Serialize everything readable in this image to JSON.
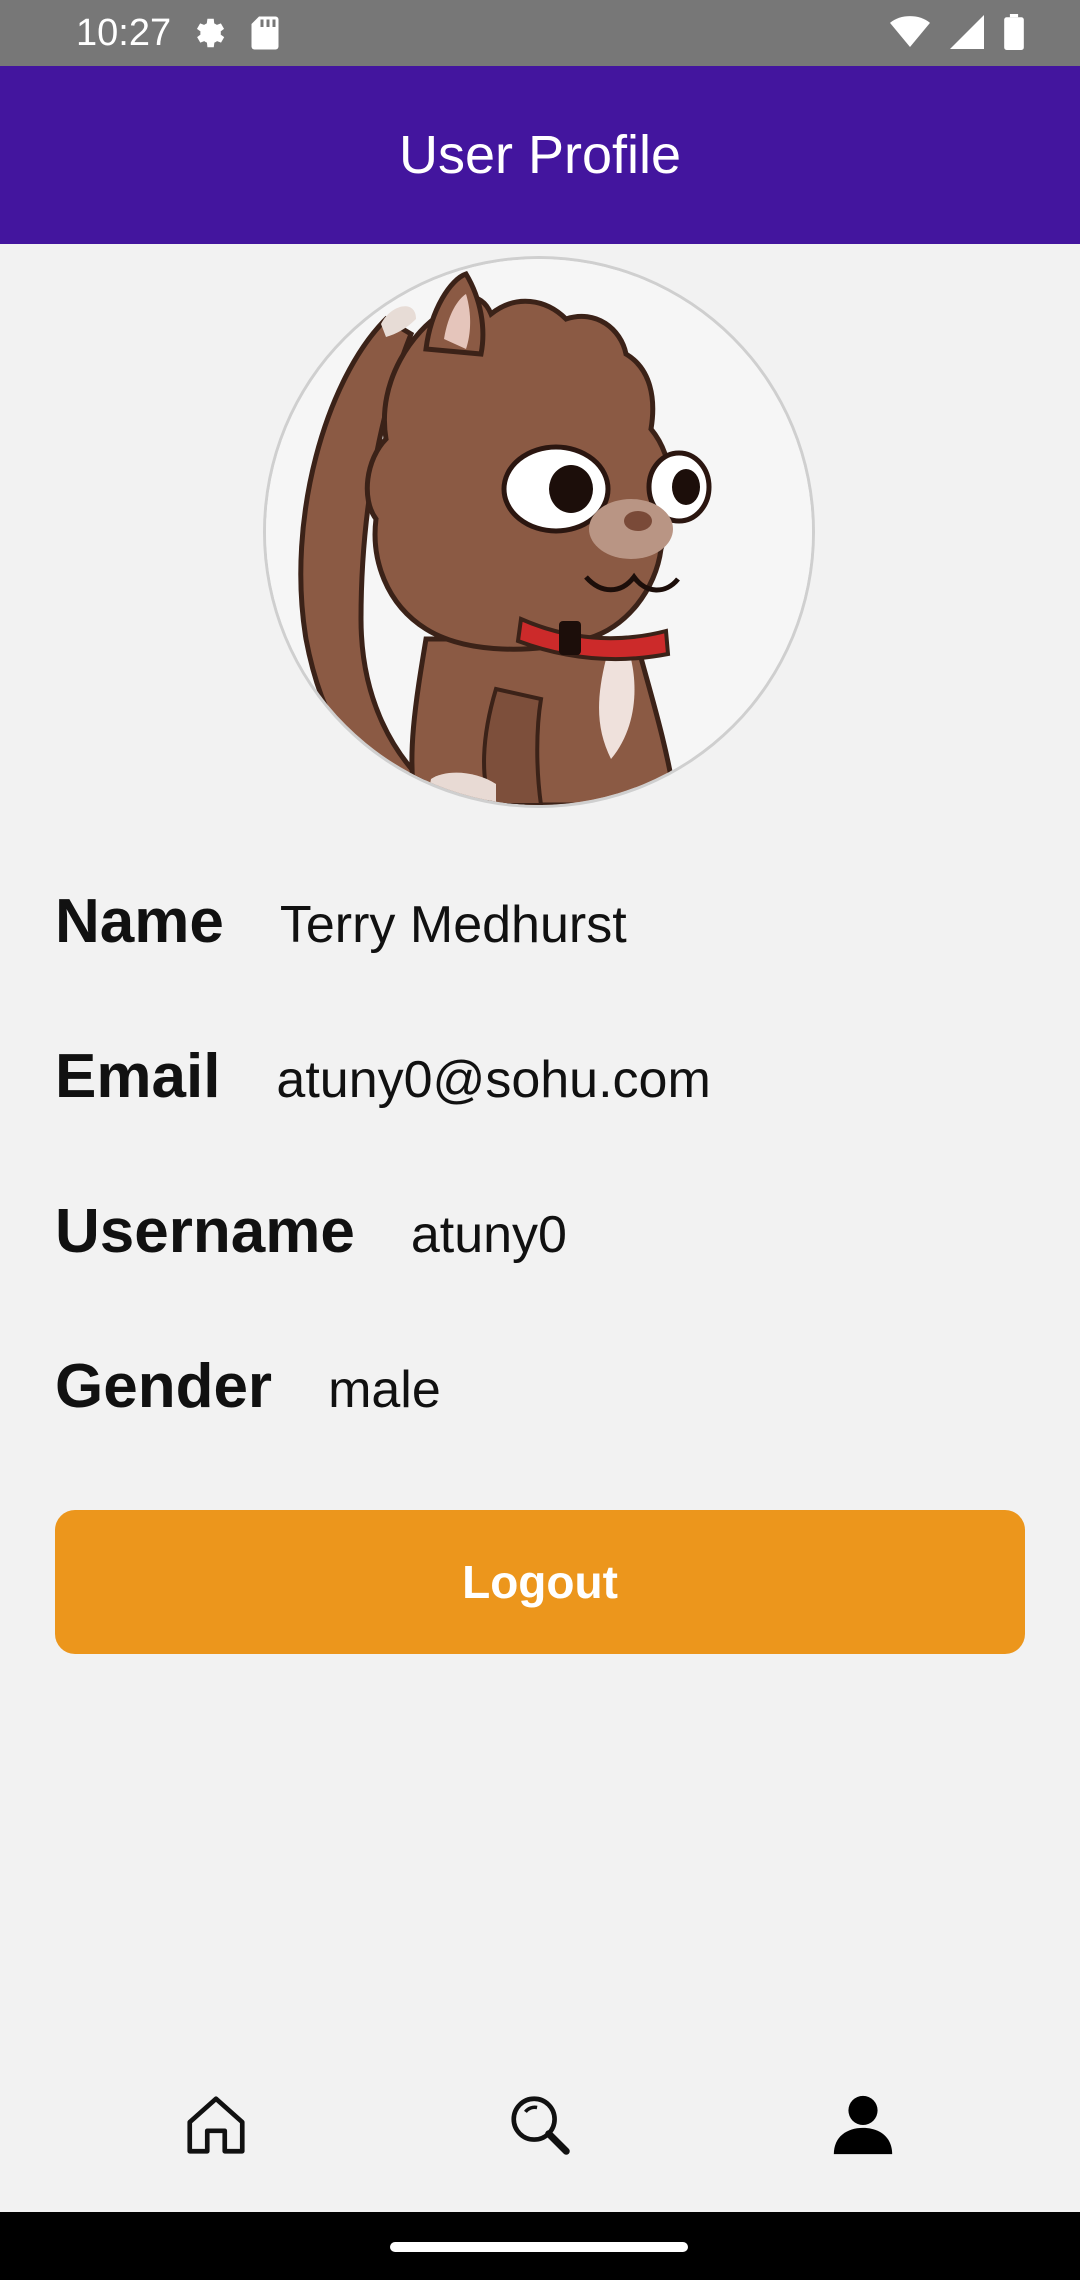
{
  "status_bar": {
    "time": "10:27",
    "icons_left": [
      "settings-icon",
      "sd-card-icon"
    ],
    "icons_right": [
      "wifi-icon",
      "signal-icon",
      "battery-icon"
    ]
  },
  "app_bar": {
    "title": "User Profile",
    "background": "#43159e"
  },
  "profile": {
    "avatar": "cartoon-cat-avatar",
    "fields": {
      "name": {
        "label": "Name",
        "value": "Terry Medhurst"
      },
      "email": {
        "label": "Email",
        "value": "atuny0@sohu.com"
      },
      "username": {
        "label": "Username",
        "value": "atuny0"
      },
      "gender": {
        "label": "Gender",
        "value": "male"
      }
    }
  },
  "actions": {
    "logout_label": "Logout",
    "logout_color": "#ec961c"
  },
  "bottom_nav": {
    "items": [
      {
        "icon": "home-icon",
        "active": false
      },
      {
        "icon": "search-icon",
        "active": false
      },
      {
        "icon": "person-icon",
        "active": true
      }
    ]
  }
}
